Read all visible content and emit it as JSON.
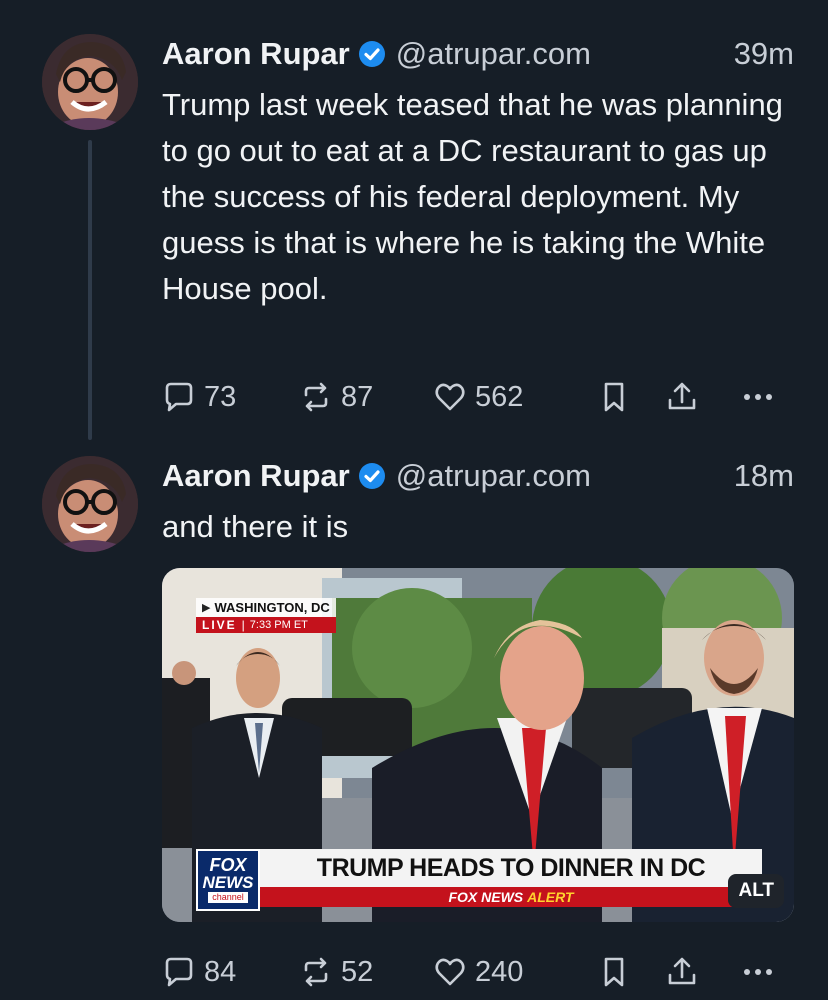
{
  "posts": [
    {
      "author": "Aaron Rupar",
      "handle": "@atrupar.com",
      "time": "39m",
      "text": "Trump last week teased that he was planning to go out to eat at a DC restaurant to gas up the success of his federal deployment. My guess is that is where he is taking the White House pool.",
      "replies": "73",
      "reposts": "87",
      "likes": "562"
    },
    {
      "author": "Aaron Rupar",
      "handle": "@atrupar.com",
      "time": "18m",
      "text": "and there it is",
      "replies": "84",
      "reposts": "52",
      "likes": "240",
      "media": {
        "location": "WASHINGTON, DC",
        "live": "LIVE",
        "live_time": "7:33 PM ET",
        "headline": "TRUMP HEADS TO DINNER IN DC",
        "alert_prefix": "FOX NEWS",
        "alert_word": "ALERT",
        "logo_line1": "FOX",
        "logo_line2": "NEWS",
        "logo_line3": "channel",
        "alt_badge": "ALT"
      }
    }
  ],
  "colors": {
    "background": "#161e27",
    "verified": "#1d8cf0",
    "text": "#f1f3f5",
    "muted": "#c8ced6"
  },
  "icons": [
    "reply-icon",
    "repost-icon",
    "like-icon",
    "bookmark-icon",
    "share-icon",
    "more-icon",
    "verified-badge-icon"
  ]
}
